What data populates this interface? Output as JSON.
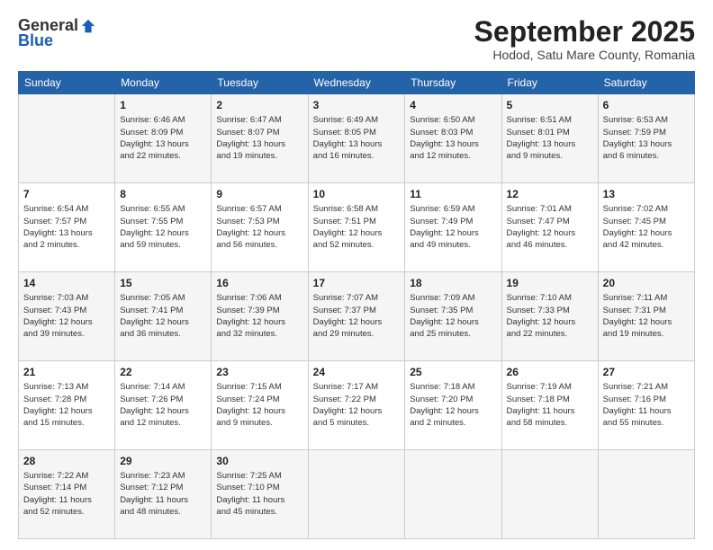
{
  "header": {
    "logo_general": "General",
    "logo_blue": "Blue",
    "month_title": "September 2025",
    "location": "Hodod, Satu Mare County, Romania"
  },
  "weekdays": [
    "Sunday",
    "Monday",
    "Tuesday",
    "Wednesday",
    "Thursday",
    "Friday",
    "Saturday"
  ],
  "weeks": [
    [
      {
        "day": "",
        "info": ""
      },
      {
        "day": "1",
        "info": "Sunrise: 6:46 AM\nSunset: 8:09 PM\nDaylight: 13 hours\nand 22 minutes."
      },
      {
        "day": "2",
        "info": "Sunrise: 6:47 AM\nSunset: 8:07 PM\nDaylight: 13 hours\nand 19 minutes."
      },
      {
        "day": "3",
        "info": "Sunrise: 6:49 AM\nSunset: 8:05 PM\nDaylight: 13 hours\nand 16 minutes."
      },
      {
        "day": "4",
        "info": "Sunrise: 6:50 AM\nSunset: 8:03 PM\nDaylight: 13 hours\nand 12 minutes."
      },
      {
        "day": "5",
        "info": "Sunrise: 6:51 AM\nSunset: 8:01 PM\nDaylight: 13 hours\nand 9 minutes."
      },
      {
        "day": "6",
        "info": "Sunrise: 6:53 AM\nSunset: 7:59 PM\nDaylight: 13 hours\nand 6 minutes."
      }
    ],
    [
      {
        "day": "7",
        "info": "Sunrise: 6:54 AM\nSunset: 7:57 PM\nDaylight: 13 hours\nand 2 minutes."
      },
      {
        "day": "8",
        "info": "Sunrise: 6:55 AM\nSunset: 7:55 PM\nDaylight: 12 hours\nand 59 minutes."
      },
      {
        "day": "9",
        "info": "Sunrise: 6:57 AM\nSunset: 7:53 PM\nDaylight: 12 hours\nand 56 minutes."
      },
      {
        "day": "10",
        "info": "Sunrise: 6:58 AM\nSunset: 7:51 PM\nDaylight: 12 hours\nand 52 minutes."
      },
      {
        "day": "11",
        "info": "Sunrise: 6:59 AM\nSunset: 7:49 PM\nDaylight: 12 hours\nand 49 minutes."
      },
      {
        "day": "12",
        "info": "Sunrise: 7:01 AM\nSunset: 7:47 PM\nDaylight: 12 hours\nand 46 minutes."
      },
      {
        "day": "13",
        "info": "Sunrise: 7:02 AM\nSunset: 7:45 PM\nDaylight: 12 hours\nand 42 minutes."
      }
    ],
    [
      {
        "day": "14",
        "info": "Sunrise: 7:03 AM\nSunset: 7:43 PM\nDaylight: 12 hours\nand 39 minutes."
      },
      {
        "day": "15",
        "info": "Sunrise: 7:05 AM\nSunset: 7:41 PM\nDaylight: 12 hours\nand 36 minutes."
      },
      {
        "day": "16",
        "info": "Sunrise: 7:06 AM\nSunset: 7:39 PM\nDaylight: 12 hours\nand 32 minutes."
      },
      {
        "day": "17",
        "info": "Sunrise: 7:07 AM\nSunset: 7:37 PM\nDaylight: 12 hours\nand 29 minutes."
      },
      {
        "day": "18",
        "info": "Sunrise: 7:09 AM\nSunset: 7:35 PM\nDaylight: 12 hours\nand 25 minutes."
      },
      {
        "day": "19",
        "info": "Sunrise: 7:10 AM\nSunset: 7:33 PM\nDaylight: 12 hours\nand 22 minutes."
      },
      {
        "day": "20",
        "info": "Sunrise: 7:11 AM\nSunset: 7:31 PM\nDaylight: 12 hours\nand 19 minutes."
      }
    ],
    [
      {
        "day": "21",
        "info": "Sunrise: 7:13 AM\nSunset: 7:28 PM\nDaylight: 12 hours\nand 15 minutes."
      },
      {
        "day": "22",
        "info": "Sunrise: 7:14 AM\nSunset: 7:26 PM\nDaylight: 12 hours\nand 12 minutes."
      },
      {
        "day": "23",
        "info": "Sunrise: 7:15 AM\nSunset: 7:24 PM\nDaylight: 12 hours\nand 9 minutes."
      },
      {
        "day": "24",
        "info": "Sunrise: 7:17 AM\nSunset: 7:22 PM\nDaylight: 12 hours\nand 5 minutes."
      },
      {
        "day": "25",
        "info": "Sunrise: 7:18 AM\nSunset: 7:20 PM\nDaylight: 12 hours\nand 2 minutes."
      },
      {
        "day": "26",
        "info": "Sunrise: 7:19 AM\nSunset: 7:18 PM\nDaylight: 11 hours\nand 58 minutes."
      },
      {
        "day": "27",
        "info": "Sunrise: 7:21 AM\nSunset: 7:16 PM\nDaylight: 11 hours\nand 55 minutes."
      }
    ],
    [
      {
        "day": "28",
        "info": "Sunrise: 7:22 AM\nSunset: 7:14 PM\nDaylight: 11 hours\nand 52 minutes."
      },
      {
        "day": "29",
        "info": "Sunrise: 7:23 AM\nSunset: 7:12 PM\nDaylight: 11 hours\nand 48 minutes."
      },
      {
        "day": "30",
        "info": "Sunrise: 7:25 AM\nSunset: 7:10 PM\nDaylight: 11 hours\nand 45 minutes."
      },
      {
        "day": "",
        "info": ""
      },
      {
        "day": "",
        "info": ""
      },
      {
        "day": "",
        "info": ""
      },
      {
        "day": "",
        "info": ""
      }
    ]
  ]
}
